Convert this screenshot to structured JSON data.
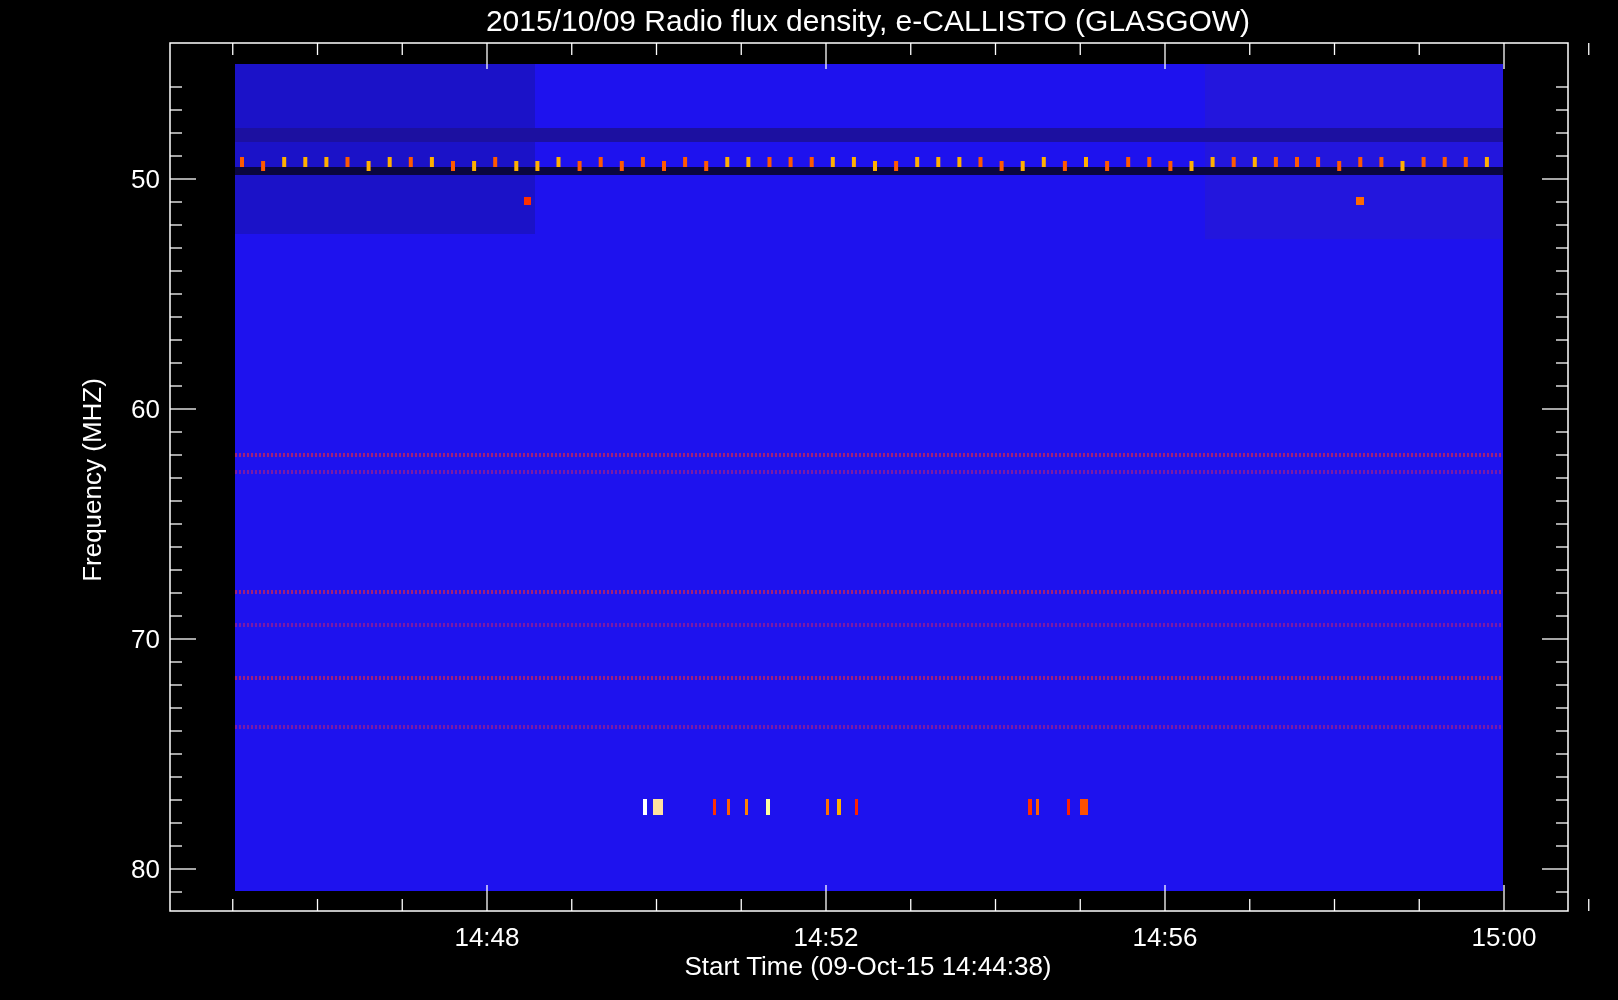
{
  "title": "2015/10/09  Radio flux density, e-CALLISTO (GLASGOW)",
  "y_axis": {
    "label": "Frequency (MHZ)",
    "ticks": [
      "50",
      "60",
      "70",
      "80"
    ]
  },
  "x_axis": {
    "label": "Start Time (09-Oct-15 14:44:38)",
    "ticks": [
      "14:48",
      "14:52",
      "14:56",
      "15:00"
    ]
  }
}
